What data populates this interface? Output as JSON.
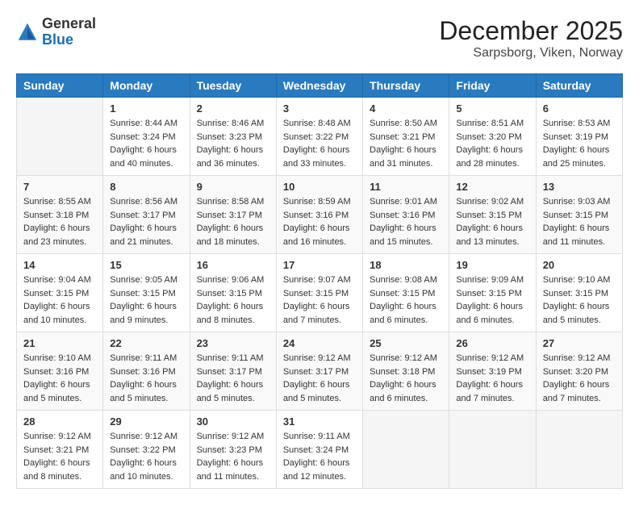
{
  "header": {
    "logo": {
      "general": "General",
      "blue": "Blue"
    },
    "title": "December 2025",
    "location": "Sarpsborg, Viken, Norway"
  },
  "calendar": {
    "days_of_week": [
      "Sunday",
      "Monday",
      "Tuesday",
      "Wednesday",
      "Thursday",
      "Friday",
      "Saturday"
    ],
    "weeks": [
      [
        {
          "day": "",
          "sunrise": "",
          "sunset": "",
          "daylight": ""
        },
        {
          "day": "1",
          "sunrise": "Sunrise: 8:44 AM",
          "sunset": "Sunset: 3:24 PM",
          "daylight": "Daylight: 6 hours and 40 minutes."
        },
        {
          "day": "2",
          "sunrise": "Sunrise: 8:46 AM",
          "sunset": "Sunset: 3:23 PM",
          "daylight": "Daylight: 6 hours and 36 minutes."
        },
        {
          "day": "3",
          "sunrise": "Sunrise: 8:48 AM",
          "sunset": "Sunset: 3:22 PM",
          "daylight": "Daylight: 6 hours and 33 minutes."
        },
        {
          "day": "4",
          "sunrise": "Sunrise: 8:50 AM",
          "sunset": "Sunset: 3:21 PM",
          "daylight": "Daylight: 6 hours and 31 minutes."
        },
        {
          "day": "5",
          "sunrise": "Sunrise: 8:51 AM",
          "sunset": "Sunset: 3:20 PM",
          "daylight": "Daylight: 6 hours and 28 minutes."
        },
        {
          "day": "6",
          "sunrise": "Sunrise: 8:53 AM",
          "sunset": "Sunset: 3:19 PM",
          "daylight": "Daylight: 6 hours and 25 minutes."
        }
      ],
      [
        {
          "day": "7",
          "sunrise": "Sunrise: 8:55 AM",
          "sunset": "Sunset: 3:18 PM",
          "daylight": "Daylight: 6 hours and 23 minutes."
        },
        {
          "day": "8",
          "sunrise": "Sunrise: 8:56 AM",
          "sunset": "Sunset: 3:17 PM",
          "daylight": "Daylight: 6 hours and 21 minutes."
        },
        {
          "day": "9",
          "sunrise": "Sunrise: 8:58 AM",
          "sunset": "Sunset: 3:17 PM",
          "daylight": "Daylight: 6 hours and 18 minutes."
        },
        {
          "day": "10",
          "sunrise": "Sunrise: 8:59 AM",
          "sunset": "Sunset: 3:16 PM",
          "daylight": "Daylight: 6 hours and 16 minutes."
        },
        {
          "day": "11",
          "sunrise": "Sunrise: 9:01 AM",
          "sunset": "Sunset: 3:16 PM",
          "daylight": "Daylight: 6 hours and 15 minutes."
        },
        {
          "day": "12",
          "sunrise": "Sunrise: 9:02 AM",
          "sunset": "Sunset: 3:15 PM",
          "daylight": "Daylight: 6 hours and 13 minutes."
        },
        {
          "day": "13",
          "sunrise": "Sunrise: 9:03 AM",
          "sunset": "Sunset: 3:15 PM",
          "daylight": "Daylight: 6 hours and 11 minutes."
        }
      ],
      [
        {
          "day": "14",
          "sunrise": "Sunrise: 9:04 AM",
          "sunset": "Sunset: 3:15 PM",
          "daylight": "Daylight: 6 hours and 10 minutes."
        },
        {
          "day": "15",
          "sunrise": "Sunrise: 9:05 AM",
          "sunset": "Sunset: 3:15 PM",
          "daylight": "Daylight: 6 hours and 9 minutes."
        },
        {
          "day": "16",
          "sunrise": "Sunrise: 9:06 AM",
          "sunset": "Sunset: 3:15 PM",
          "daylight": "Daylight: 6 hours and 8 minutes."
        },
        {
          "day": "17",
          "sunrise": "Sunrise: 9:07 AM",
          "sunset": "Sunset: 3:15 PM",
          "daylight": "Daylight: 6 hours and 7 minutes."
        },
        {
          "day": "18",
          "sunrise": "Sunrise: 9:08 AM",
          "sunset": "Sunset: 3:15 PM",
          "daylight": "Daylight: 6 hours and 6 minutes."
        },
        {
          "day": "19",
          "sunrise": "Sunrise: 9:09 AM",
          "sunset": "Sunset: 3:15 PM",
          "daylight": "Daylight: 6 hours and 6 minutes."
        },
        {
          "day": "20",
          "sunrise": "Sunrise: 9:10 AM",
          "sunset": "Sunset: 3:15 PM",
          "daylight": "Daylight: 6 hours and 5 minutes."
        }
      ],
      [
        {
          "day": "21",
          "sunrise": "Sunrise: 9:10 AM",
          "sunset": "Sunset: 3:16 PM",
          "daylight": "Daylight: 6 hours and 5 minutes."
        },
        {
          "day": "22",
          "sunrise": "Sunrise: 9:11 AM",
          "sunset": "Sunset: 3:16 PM",
          "daylight": "Daylight: 6 hours and 5 minutes."
        },
        {
          "day": "23",
          "sunrise": "Sunrise: 9:11 AM",
          "sunset": "Sunset: 3:17 PM",
          "daylight": "Daylight: 6 hours and 5 minutes."
        },
        {
          "day": "24",
          "sunrise": "Sunrise: 9:12 AM",
          "sunset": "Sunset: 3:17 PM",
          "daylight": "Daylight: 6 hours and 5 minutes."
        },
        {
          "day": "25",
          "sunrise": "Sunrise: 9:12 AM",
          "sunset": "Sunset: 3:18 PM",
          "daylight": "Daylight: 6 hours and 6 minutes."
        },
        {
          "day": "26",
          "sunrise": "Sunrise: 9:12 AM",
          "sunset": "Sunset: 3:19 PM",
          "daylight": "Daylight: 6 hours and 7 minutes."
        },
        {
          "day": "27",
          "sunrise": "Sunrise: 9:12 AM",
          "sunset": "Sunset: 3:20 PM",
          "daylight": "Daylight: 6 hours and 7 minutes."
        }
      ],
      [
        {
          "day": "28",
          "sunrise": "Sunrise: 9:12 AM",
          "sunset": "Sunset: 3:21 PM",
          "daylight": "Daylight: 6 hours and 8 minutes."
        },
        {
          "day": "29",
          "sunrise": "Sunrise: 9:12 AM",
          "sunset": "Sunset: 3:22 PM",
          "daylight": "Daylight: 6 hours and 10 minutes."
        },
        {
          "day": "30",
          "sunrise": "Sunrise: 9:12 AM",
          "sunset": "Sunset: 3:23 PM",
          "daylight": "Daylight: 6 hours and 11 minutes."
        },
        {
          "day": "31",
          "sunrise": "Sunrise: 9:11 AM",
          "sunset": "Sunset: 3:24 PM",
          "daylight": "Daylight: 6 hours and 12 minutes."
        },
        {
          "day": "",
          "sunrise": "",
          "sunset": "",
          "daylight": ""
        },
        {
          "day": "",
          "sunrise": "",
          "sunset": "",
          "daylight": ""
        },
        {
          "day": "",
          "sunrise": "",
          "sunset": "",
          "daylight": ""
        }
      ]
    ]
  }
}
